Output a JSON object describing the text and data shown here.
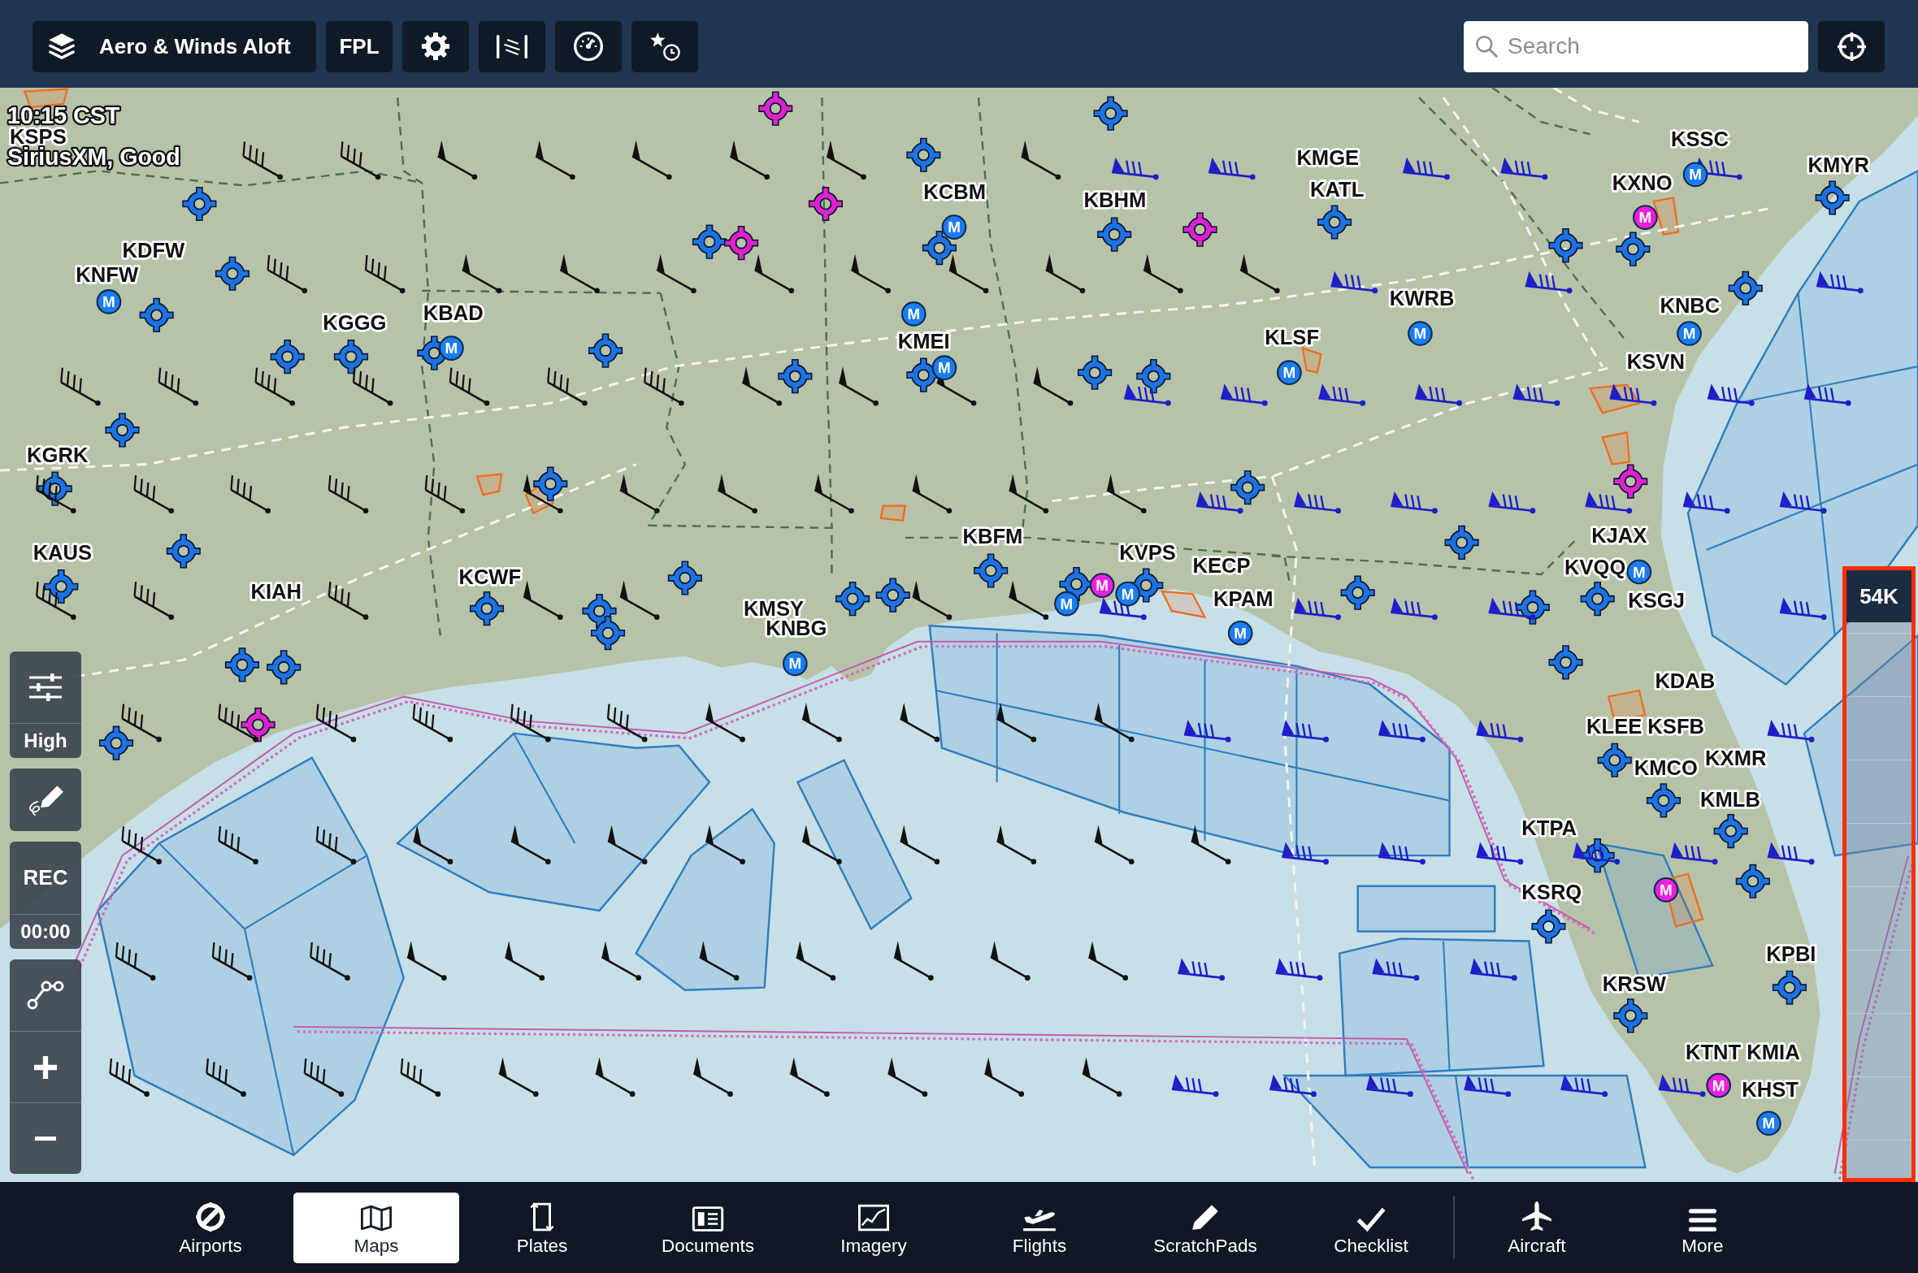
{
  "toolbar": {
    "layers_button": {
      "label": "Aero & Winds Aloft"
    },
    "fpl_button": {
      "label": "FPL"
    },
    "search": {
      "placeholder": "Search"
    }
  },
  "map": {
    "status": {
      "time": "10:15 CST",
      "connection": "SiriusXM, Good"
    },
    "airport_labels": [
      {
        "text": "KSPS"
      },
      {
        "text": "KMGE"
      },
      {
        "text": "KSSC"
      },
      {
        "text": "KMYR"
      },
      {
        "text": "KCBM"
      },
      {
        "text": "KBHM"
      },
      {
        "text": "KATL"
      },
      {
        "text": "KXNO"
      },
      {
        "text": "KDFW"
      },
      {
        "text": "KNFW"
      },
      {
        "text": "KGGG"
      },
      {
        "text": "KBAD"
      },
      {
        "text": "KWRB"
      },
      {
        "text": "KNBC"
      },
      {
        "text": "KMEI"
      },
      {
        "text": "KLSF"
      },
      {
        "text": "KSVN"
      },
      {
        "text": "KGRK"
      },
      {
        "text": "KAUS"
      },
      {
        "text": "KBFM"
      },
      {
        "text": "KVPS"
      },
      {
        "text": "KJAX"
      },
      {
        "text": "KIAH"
      },
      {
        "text": "KCWF"
      },
      {
        "text": "KECP"
      },
      {
        "text": "KVQQ"
      },
      {
        "text": "KMSY"
      },
      {
        "text": "KPAM"
      },
      {
        "text": "KSGJ"
      },
      {
        "text": "KNBG"
      },
      {
        "text": "KDAB"
      },
      {
        "text": "KLEE"
      },
      {
        "text": "KSFB"
      },
      {
        "text": "KMCO"
      },
      {
        "text": "KXMR"
      },
      {
        "text": "KMLB"
      },
      {
        "text": "KTPA"
      },
      {
        "text": "KSRQ"
      },
      {
        "text": "KPBI"
      },
      {
        "text": "KRSW"
      },
      {
        "text": "KTNT"
      },
      {
        "text": "KMIA"
      },
      {
        "text": "KHST"
      }
    ],
    "markers": [
      {
        "label": "M",
        "color": "#1c7cf4"
      },
      {
        "label": "M",
        "color": "#1c7cf4"
      },
      {
        "label": "M",
        "color": "#1c7cf4"
      },
      {
        "label": "M",
        "color": "#1c7cf4"
      },
      {
        "label": "M",
        "color": "#1c7cf4"
      },
      {
        "label": "M",
        "color": "#1c7cf4"
      },
      {
        "label": "M",
        "color": "#1c7cf4"
      },
      {
        "label": "M",
        "color": "#1c7cf4"
      },
      {
        "label": "M",
        "color": "#1c7cf4"
      },
      {
        "label": "M",
        "color": "#1c7cf4"
      },
      {
        "label": "M",
        "color": "#1c7cf4"
      },
      {
        "label": "M",
        "color": "#1c7cf4"
      },
      {
        "label": "M",
        "color": "#1c7cf4"
      },
      {
        "label": "M",
        "color": "#1c7cf4"
      },
      {
        "label": "M",
        "color": "#1c7cf4"
      },
      {
        "label": "M",
        "color": "#ec1fe0"
      },
      {
        "label": "M",
        "color": "#ec1fe0"
      },
      {
        "label": "M",
        "color": "#ec1fe0"
      },
      {
        "label": "M",
        "color": "#ec1fe0"
      }
    ],
    "controls": {
      "detail_level": "High",
      "record": "REC",
      "timer": "00:00"
    },
    "altitude_slider": {
      "label": "54K",
      "level": 1
    }
  },
  "tabs": [
    {
      "label": "Airports",
      "selected": false
    },
    {
      "label": "Maps",
      "selected": true
    },
    {
      "label": "Plates",
      "selected": false
    },
    {
      "label": "Documents",
      "selected": false
    },
    {
      "label": "Imagery",
      "selected": false
    },
    {
      "label": "Flights",
      "selected": false
    },
    {
      "label": "ScratchPads",
      "selected": false
    },
    {
      "label": "Checklist",
      "selected": false
    },
    {
      "label": "Aircraft",
      "selected": false
    },
    {
      "label": "More",
      "selected": false
    }
  ]
}
